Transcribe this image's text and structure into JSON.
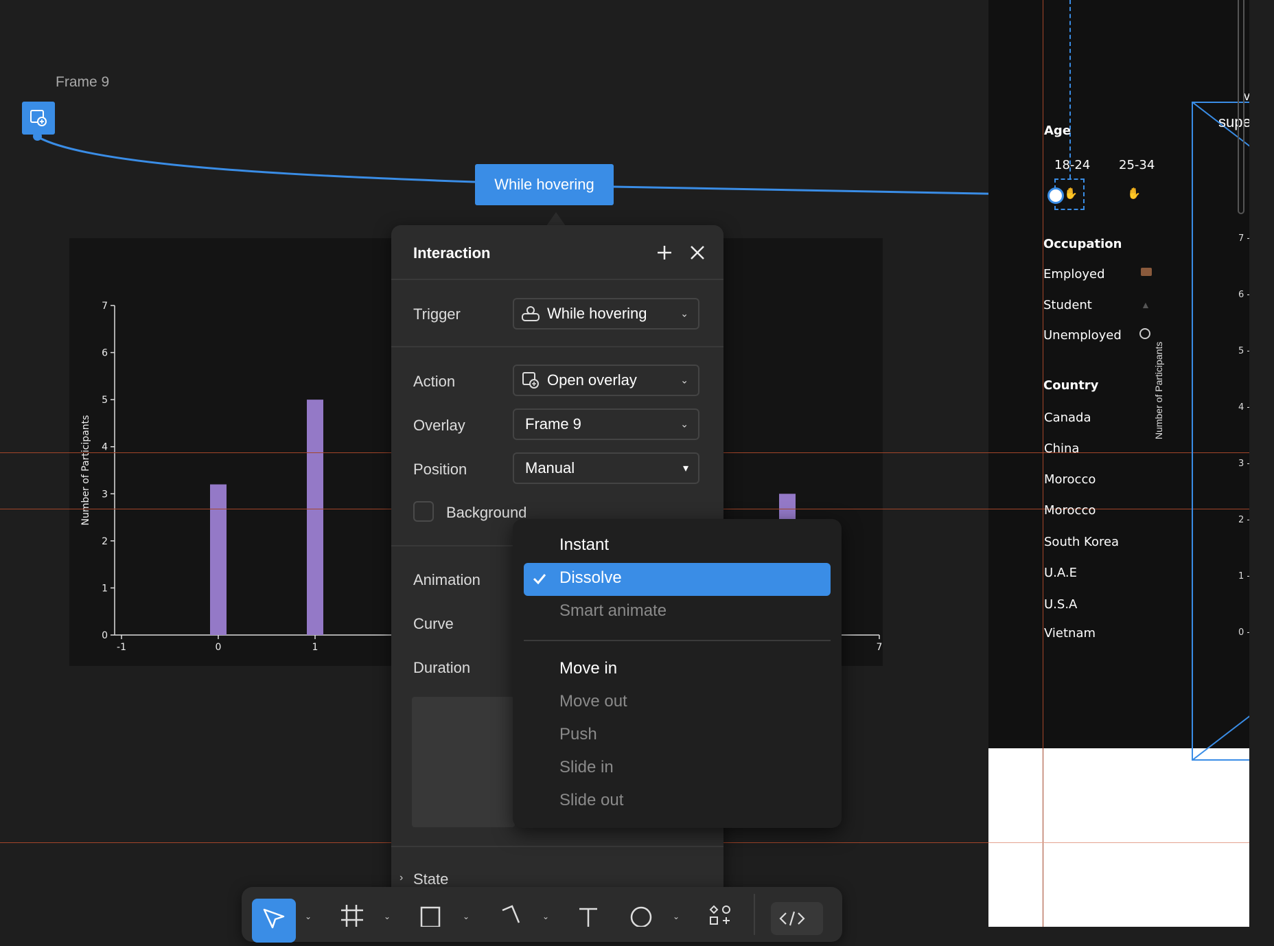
{
  "canvas": {
    "frame_label": "Frame 9",
    "connection_label": "While hovering"
  },
  "right_frame": {
    "age_heading": "Age",
    "age_groups": [
      "18-24",
      "25-34"
    ],
    "occupation_heading": "Occupation",
    "occupations": [
      {
        "label": "Employed",
        "icon": "briefcase-icon"
      },
      {
        "label": "Student",
        "icon": "graduation-cap-icon"
      },
      {
        "label": "Unemployed",
        "icon": "magnifier-icon"
      }
    ],
    "country_heading": "Country",
    "countries": [
      "Canada",
      "China",
      "Morocco",
      "Morocco",
      "South Korea",
      "U.A.E",
      "U.S.A",
      "Vietnam"
    ],
    "cut_text": "supe",
    "cut_text_top": "v",
    "ylabel": "Number of Participants",
    "yticks": [
      "7",
      "6",
      "5",
      "4",
      "3",
      "2",
      "1",
      "0"
    ]
  },
  "panel": {
    "title": "Interaction",
    "trigger_label": "Trigger",
    "trigger_value": "While hovering",
    "action_label": "Action",
    "action_value": "Open overlay",
    "overlay_label": "Overlay",
    "overlay_value": "Frame 9",
    "position_label": "Position",
    "position_value": "Manual",
    "background_label": "Background",
    "animation_label": "Animation",
    "curve_label": "Curve",
    "duration_label": "Duration",
    "state_label": "State"
  },
  "menu": {
    "items": [
      {
        "label": "Instant",
        "enabled": true
      },
      {
        "label": "Dissolve",
        "enabled": true,
        "selected": true
      },
      {
        "label": "Smart animate",
        "enabled": false
      },
      {
        "label": "Move in",
        "enabled": true
      },
      {
        "label": "Move out",
        "enabled": false
      },
      {
        "label": "Push",
        "enabled": false
      },
      {
        "label": "Slide in",
        "enabled": false
      },
      {
        "label": "Slide out",
        "enabled": false
      }
    ]
  },
  "chart_data": {
    "type": "bar",
    "xlabel": "",
    "ylabel": "Number of Participants",
    "xlim": [
      -1,
      7
    ],
    "ylim": [
      0,
      7
    ],
    "x_ticks": [
      "-1",
      "0",
      "1",
      "7"
    ],
    "y_ticks": [
      "0",
      "1",
      "2",
      "3",
      "4",
      "5",
      "6",
      "7"
    ],
    "series": [
      {
        "x": [
          0,
          1,
          6
        ],
        "values": [
          3.2,
          5,
          3
        ]
      }
    ],
    "bar_color": "#9479c7"
  },
  "colors": {
    "accent": "#3a8de6",
    "guide": "#a4462a",
    "panel_bg": "#2c2c2c"
  }
}
